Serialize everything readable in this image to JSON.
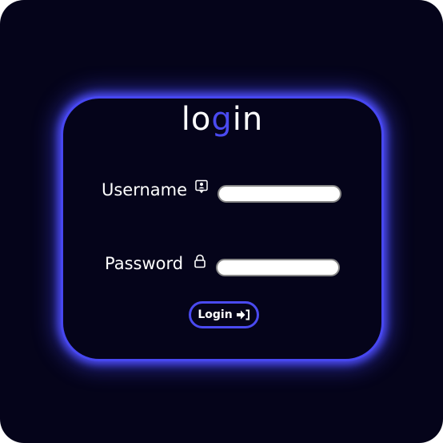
{
  "form": {
    "title_part1": "lo",
    "title_accent": "g",
    "title_part2": "in",
    "username_label": "Username",
    "username_icon": "user-badge-icon",
    "username_value": "",
    "password_label": "Password",
    "password_icon": "lock-icon",
    "password_value": "",
    "submit_label": "Login",
    "submit_icon": "sign-in-icon"
  },
  "colors": {
    "background": "#05041a",
    "accent": "#4a4af0",
    "text": "#ffffff"
  }
}
